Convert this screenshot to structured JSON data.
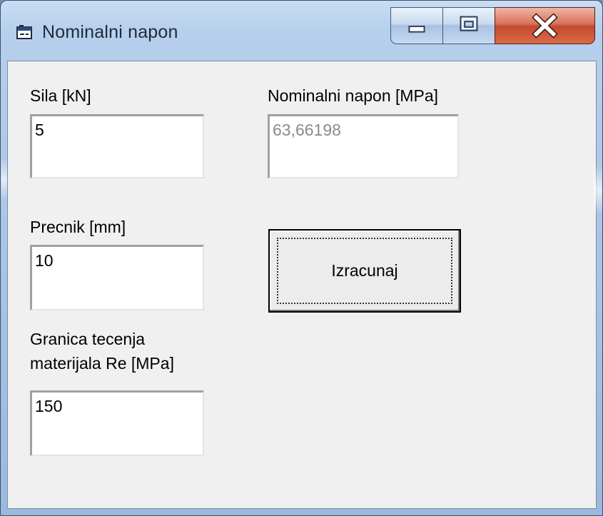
{
  "window": {
    "title": "Nominalni napon",
    "icon": "window-app-icon",
    "controls": [
      "minimize-icon",
      "maximize-icon",
      "close-icon"
    ]
  },
  "form": {
    "force": {
      "label": "Sila [kN]",
      "value": "5"
    },
    "diameter": {
      "label": "Precnik [mm]",
      "value": "10"
    },
    "yield": {
      "label_line1": "Granica tecenja",
      "label_line2": "materijala Re [MPa]",
      "value": "150"
    },
    "stress": {
      "label": "Nominalni napon [MPa]",
      "value": "63,66198"
    },
    "calculate_label": "Izracunaj"
  },
  "colors": {
    "close_button": "#c44a30",
    "face": "#f0f0f0",
    "readonly_text": "#8a8a8a"
  }
}
